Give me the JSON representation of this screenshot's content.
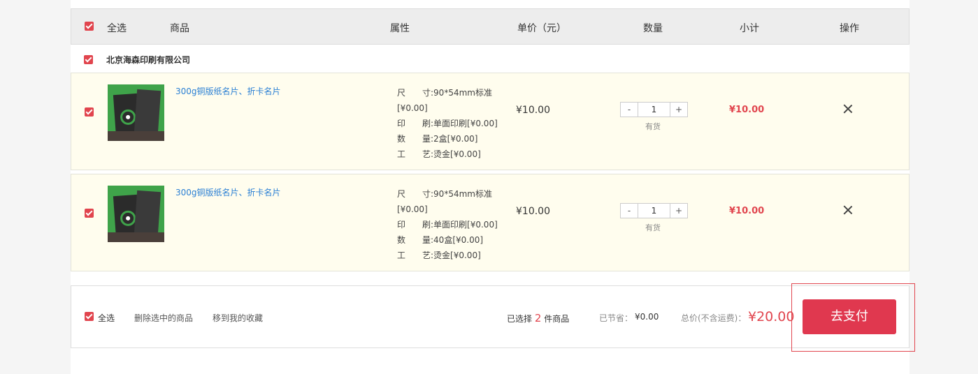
{
  "header": {
    "select_all": "全选",
    "product": "商品",
    "attributes": "属性",
    "unit_price": "单价（元）",
    "quantity": "数量",
    "subtotal": "小计",
    "action": "操作"
  },
  "shop": {
    "name": "北京海森印刷有限公司"
  },
  "items": [
    {
      "name": "300g铜版纸名片、折卡名片",
      "attrs": [
        {
          "key": "尺　　",
          "val": "寸:90*54mm标准"
        },
        {
          "key": "",
          "val": "[¥0.00]"
        },
        {
          "key": "印　　",
          "val": "刷:单面印刷[¥0.00]"
        },
        {
          "key": "数　　",
          "val": "量:2盒[¥0.00]"
        },
        {
          "key": "工　　",
          "val": "艺:烫金[¥0.00]"
        }
      ],
      "price": "¥10.00",
      "qty": "1",
      "minus": "-",
      "plus": "+",
      "stock": "有货",
      "subtotal": "¥10.00"
    },
    {
      "name": "300g铜版纸名片、折卡名片",
      "attrs": [
        {
          "key": "尺　　",
          "val": "寸:90*54mm标准"
        },
        {
          "key": "",
          "val": "[¥0.00]"
        },
        {
          "key": "印　　",
          "val": "刷:单面印刷[¥0.00]"
        },
        {
          "key": "数　　",
          "val": "量:40盒[¥0.00]"
        },
        {
          "key": "工　　",
          "val": "艺:烫金[¥0.00]"
        }
      ],
      "price": "¥10.00",
      "qty": "1",
      "minus": "-",
      "plus": "+",
      "stock": "有货",
      "subtotal": "¥10.00"
    }
  ],
  "footer": {
    "select_all": "全选",
    "delete_selected": "删除选中的商品",
    "move_to_favorites": "移到我的收藏",
    "selected_prefix": "已选择",
    "selected_count": "2",
    "selected_suffix": "件商品",
    "saved_label": "已节省：",
    "saved_value": "¥0.00",
    "total_label": "总价(不含运费)：",
    "total_value": "¥20.00",
    "pay_button": "去支付"
  },
  "colors": {
    "accent": "#e1454e",
    "pay": "#e0384f",
    "link": "#2a7fd4",
    "row_bg": "#fffdee"
  }
}
